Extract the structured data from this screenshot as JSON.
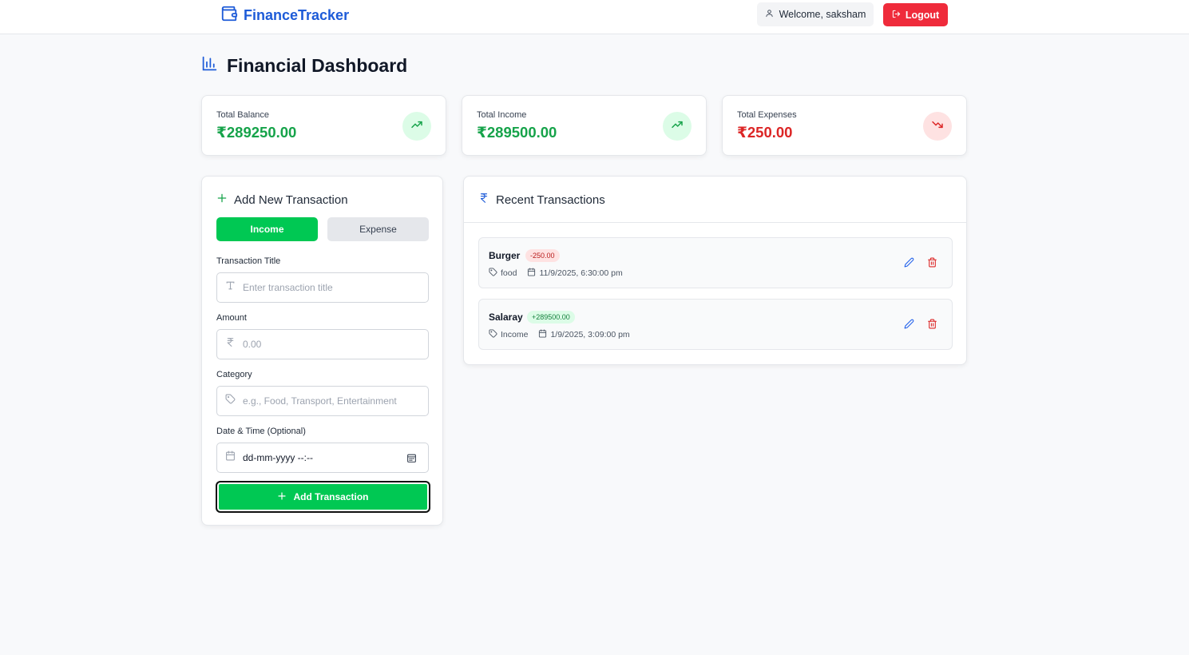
{
  "header": {
    "brand": "FinanceTracker",
    "welcome": "Welcome, saksham",
    "logout": "Logout"
  },
  "page": {
    "title": "Financial Dashboard"
  },
  "stats": [
    {
      "label": "Total Balance",
      "value": "₹289250.00",
      "color": "#16a34a",
      "trend": "up"
    },
    {
      "label": "Total Income",
      "value": "₹289500.00",
      "color": "#16a34a",
      "trend": "up"
    },
    {
      "label": "Total Expenses",
      "value": "₹250.00",
      "color": "#dc2626",
      "trend": "down"
    }
  ],
  "form": {
    "title": "Add New Transaction",
    "type_income": "Income",
    "type_expense": "Expense",
    "selected_type": "Income",
    "title_label": "Transaction Title",
    "title_placeholder": "Enter transaction title",
    "amount_label": "Amount",
    "amount_placeholder": "0.00",
    "category_label": "Category",
    "category_placeholder": "e.g., Food, Transport, Entertainment",
    "date_label": "Date & Time (Optional)",
    "date_value": "dd-mm-yyyy  --:--",
    "submit": "Add Transaction"
  },
  "recent": {
    "title": "Recent Transactions",
    "items": [
      {
        "name": "Burger",
        "amount": "-250.00",
        "kind": "expense",
        "category": "food",
        "datetime": "11/9/2025, 6:30:00 pm"
      },
      {
        "name": "Salaray",
        "amount": "+289500.00",
        "kind": "income",
        "category": "Income",
        "datetime": "1/9/2025, 3:09:00 pm"
      }
    ]
  },
  "colors": {
    "accent": "#1d5bd8",
    "income": "#00c853",
    "danger": "#ef2b3b"
  }
}
